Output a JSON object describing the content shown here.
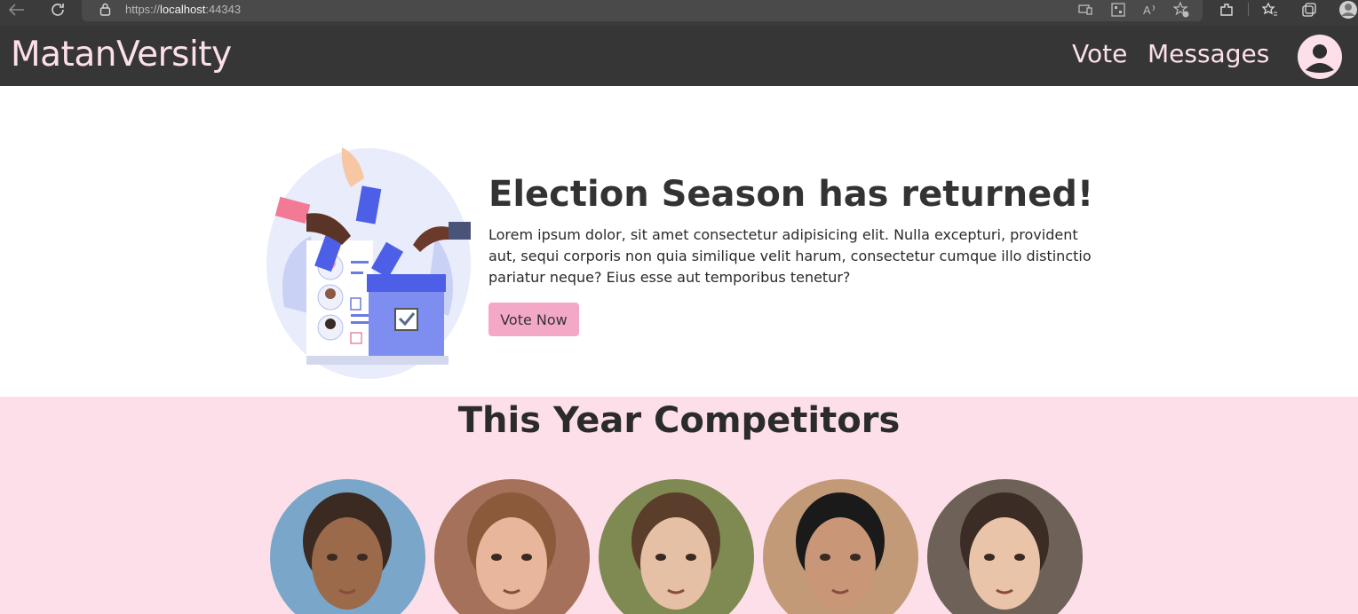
{
  "browser": {
    "url_scheme": "https://",
    "url_host": "localhost",
    "url_port": ":44343"
  },
  "navbar": {
    "brand": "MatanVersity",
    "links": [
      "Vote",
      "Messages"
    ]
  },
  "hero": {
    "title": "Election Season has returned!",
    "text": "Lorem ipsum dolor, sit amet consectetur adipisicing elit. Nulla excepturi, provident aut, sequi corporis non quia similique velit harum, consectetur cumque illo distinctio pariatur neque? Eius esse aut temporibus tenetur?",
    "button": "Vote Now"
  },
  "competitors": {
    "title": "This Year Competitors",
    "avatars": [
      {
        "name_icon": "competitor-1-photo",
        "bg": "#7aa6c9",
        "skin": "#9b6a4a",
        "hair": "#3a2a22"
      },
      {
        "name_icon": "competitor-2-photo",
        "bg": "#a5715a",
        "skin": "#e8b79b",
        "hair": "#8a5a3a"
      },
      {
        "name_icon": "competitor-3-photo",
        "bg": "#7f8a52",
        "skin": "#e6c0a5",
        "hair": "#5a3d2a"
      },
      {
        "name_icon": "competitor-4-photo",
        "bg": "#c29a77",
        "skin": "#c99678",
        "hair": "#1a1a1a"
      },
      {
        "name_icon": "competitor-5-photo",
        "bg": "#6e6258",
        "skin": "#eac4a8",
        "hair": "#3b2d26"
      }
    ]
  },
  "colors": {
    "navbar_bg": "#363636",
    "accent_pink": "#fcdfe9",
    "button_pink": "#f4a8c8"
  }
}
